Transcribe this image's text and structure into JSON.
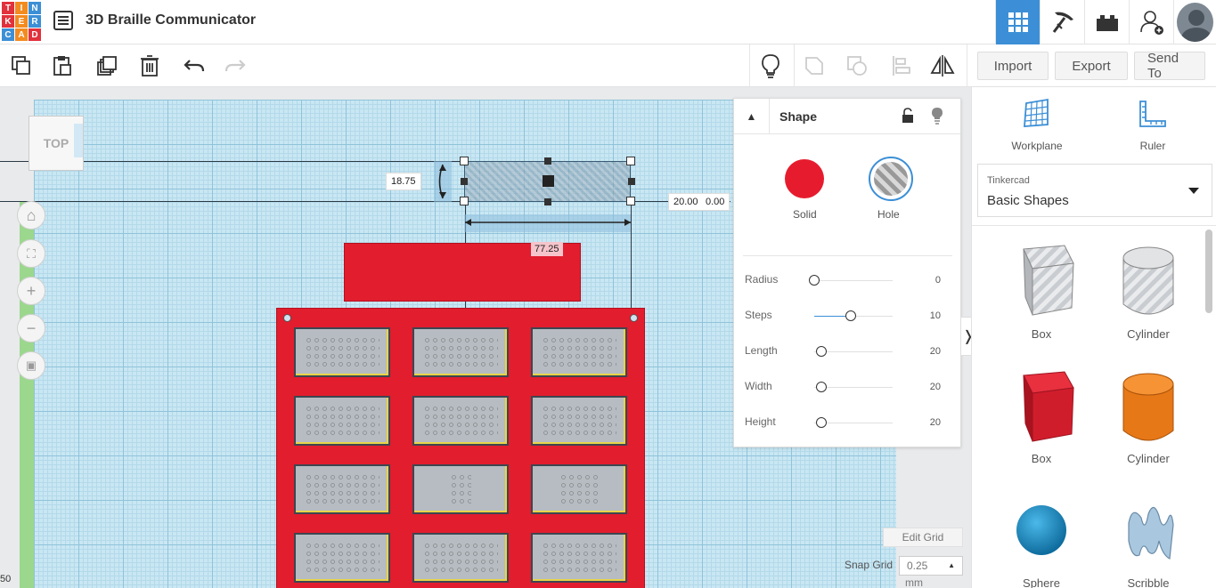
{
  "app": {
    "logo_letters": [
      "T",
      "I",
      "N",
      "K",
      "E",
      "R",
      "C",
      "A",
      "D"
    ],
    "logo_colors": [
      "#e2313c",
      "#f38b1f",
      "#3c8fd6",
      "#e2313c",
      "#f38b1f",
      "#3c8fd6",
      "#3c8fd6",
      "#f38b1f",
      "#e2313c"
    ],
    "title": "3D Braille Communicator"
  },
  "header_icons": [
    "grid-view-icon",
    "pickaxe-icon",
    "bricks-icon",
    "add-user-icon",
    "avatar"
  ],
  "toolbar": {
    "import_label": "Import",
    "export_label": "Export",
    "send_to_label": "Send To"
  },
  "viewcube": {
    "label": "TOP"
  },
  "selection": {
    "height_value": "18.75",
    "width_value": "20.00",
    "offset_value": "0.00",
    "length_value": "77.25"
  },
  "shape_panel": {
    "title": "Shape",
    "solid_label": "Solid",
    "hole_label": "Hole",
    "solid_color": "#e61c2e",
    "params": [
      {
        "label": "Radius",
        "value": "0"
      },
      {
        "label": "Steps",
        "value": "10"
      },
      {
        "label": "Length",
        "value": "20"
      },
      {
        "label": "Width",
        "value": "20"
      },
      {
        "label": "Height",
        "value": "20"
      }
    ]
  },
  "grid_controls": {
    "edit_grid_label": "Edit Grid",
    "snap_grid_label": "Snap Grid",
    "snap_value": "0.25",
    "snap_unit": "mm"
  },
  "coordinate_edge": "50",
  "sidebar": {
    "workplane_label": "Workplane",
    "ruler_label": "Ruler",
    "library_category": "Tinkercad",
    "library_name": "Basic Shapes",
    "shapes": [
      {
        "name": "Box",
        "kind": "hole-box"
      },
      {
        "name": "Cylinder",
        "kind": "hole-cylinder"
      },
      {
        "name": "Box",
        "kind": "red-box"
      },
      {
        "name": "Cylinder",
        "kind": "orange-cylinder"
      },
      {
        "name": "Sphere",
        "kind": "blue-sphere"
      },
      {
        "name": "Scribble",
        "kind": "scribble"
      }
    ]
  }
}
